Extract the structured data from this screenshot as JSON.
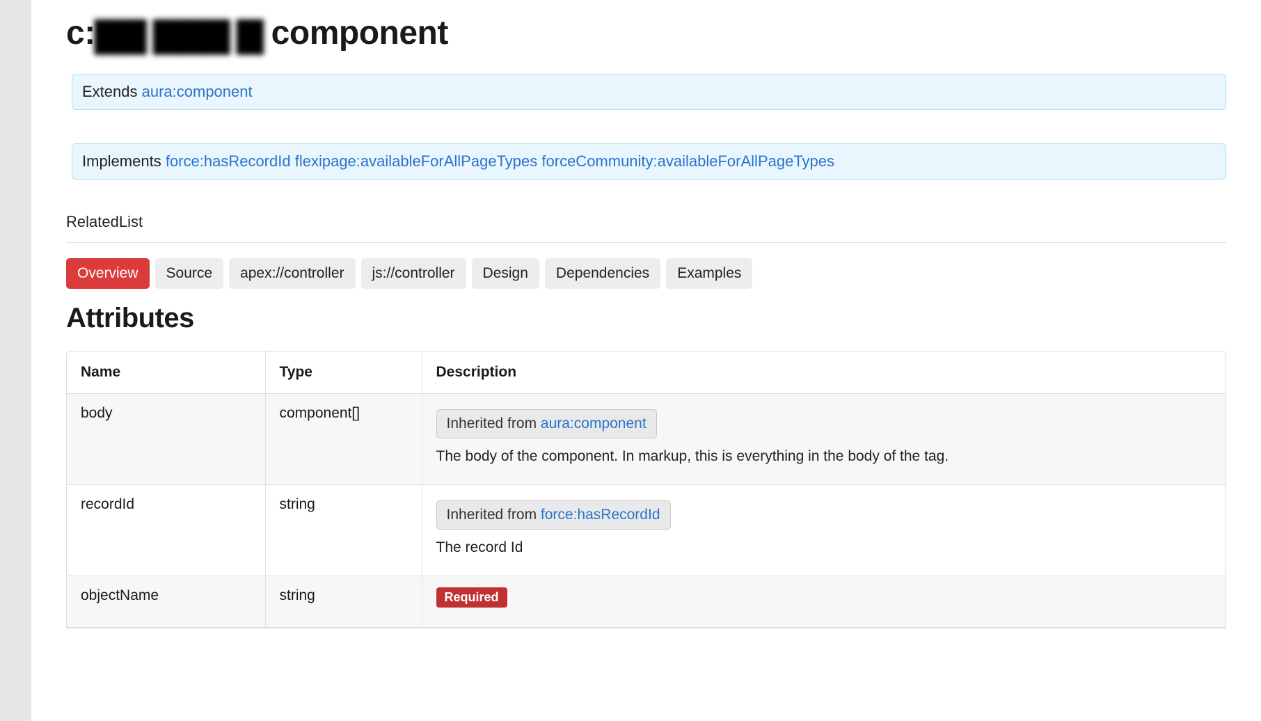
{
  "title": {
    "prefix": "c:",
    "redacted": "▇▇ ▇▇▇ ▇",
    "suffix": " component"
  },
  "extends": {
    "label": "Extends ",
    "link": "aura:component"
  },
  "implements": {
    "label": "Implements ",
    "links": [
      "force:hasRecordId",
      "flexipage:availableForAllPageTypes",
      "forceCommunity:availableForAllPageTypes"
    ]
  },
  "related_label": "RelatedList",
  "tabs": [
    {
      "label": "Overview",
      "active": true
    },
    {
      "label": "Source",
      "active": false
    },
    {
      "label": "apex://controller",
      "active": false
    },
    {
      "label": "js://controller",
      "active": false
    },
    {
      "label": "Design",
      "active": false
    },
    {
      "label": "Dependencies",
      "active": false
    },
    {
      "label": "Examples",
      "active": false
    }
  ],
  "attributes_heading": "Attributes",
  "attributes_columns": [
    "Name",
    "Type",
    "Description"
  ],
  "inherited_prefix": "Inherited from ",
  "required_label": "Required",
  "attributes": [
    {
      "name": "body",
      "type": "component[]",
      "inherited_from": "aura:component",
      "description": "The body of the component. In markup, this is everything in the body of the tag.",
      "required": false
    },
    {
      "name": "recordId",
      "type": "string",
      "inherited_from": "force:hasRecordId",
      "description": "The record Id",
      "required": false
    },
    {
      "name": "objectName",
      "type": "string",
      "inherited_from": null,
      "description": "",
      "required": true
    }
  ]
}
